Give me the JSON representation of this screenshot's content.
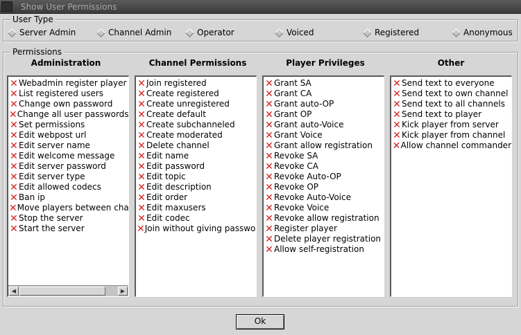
{
  "window": {
    "title": "Show User Permissions"
  },
  "user_type": {
    "legend": "User Type",
    "options": [
      "Server Admin",
      "Channel Admin",
      "Operator",
      "Voiced",
      "Registered",
      "Anonymous"
    ]
  },
  "permissions": {
    "legend": "Permissions",
    "columns": [
      {
        "header": "Administration",
        "items": [
          "Webadmin register player",
          "List registered users",
          "Change own password",
          "Change all user passwords",
          "Set permissions",
          "Edit webpost url",
          "Edit server name",
          "Edit welcome message",
          "Edit server password",
          "Edit server type",
          "Edit allowed codecs",
          "Ban ip",
          "Move players between channels",
          "Stop the server",
          "Start the server"
        ]
      },
      {
        "header": "Channel Permissions",
        "items": [
          "Join registered",
          "Create registered",
          "Create unregistered",
          "Create default",
          "Create subchanneled",
          "Create moderated",
          "Delete channel",
          "Edit name",
          "Edit password",
          "Edit topic",
          "Edit description",
          "Edit order",
          "Edit maxusers",
          "Edit codec",
          "Join without giving password"
        ]
      },
      {
        "header": "Player Privileges",
        "items": [
          "Grant SA",
          "Grant CA",
          "Grant auto-OP",
          "Grant OP",
          "Grant auto-Voice",
          "Grant Voice",
          "Grant allow registration",
          "Revoke SA",
          "Revoke CA",
          "Revoke Auto-OP",
          "Revoke OP",
          "Revoke Auto-Voice",
          "Revoke Voice",
          "Revoke allow registration",
          "Register player",
          "Delete player registration",
          "Allow self-registration"
        ]
      },
      {
        "header": "Other",
        "items": [
          "Send text to everyone",
          "Send text to own channel",
          "Send text to all channels",
          "Send text to player",
          "Kick player from server",
          "Kick player from channel",
          "Allow channel commander"
        ]
      }
    ]
  },
  "icons": {
    "denied": "red-x-icon",
    "denied_color": "#d42020"
  },
  "ok_label": "Ok"
}
